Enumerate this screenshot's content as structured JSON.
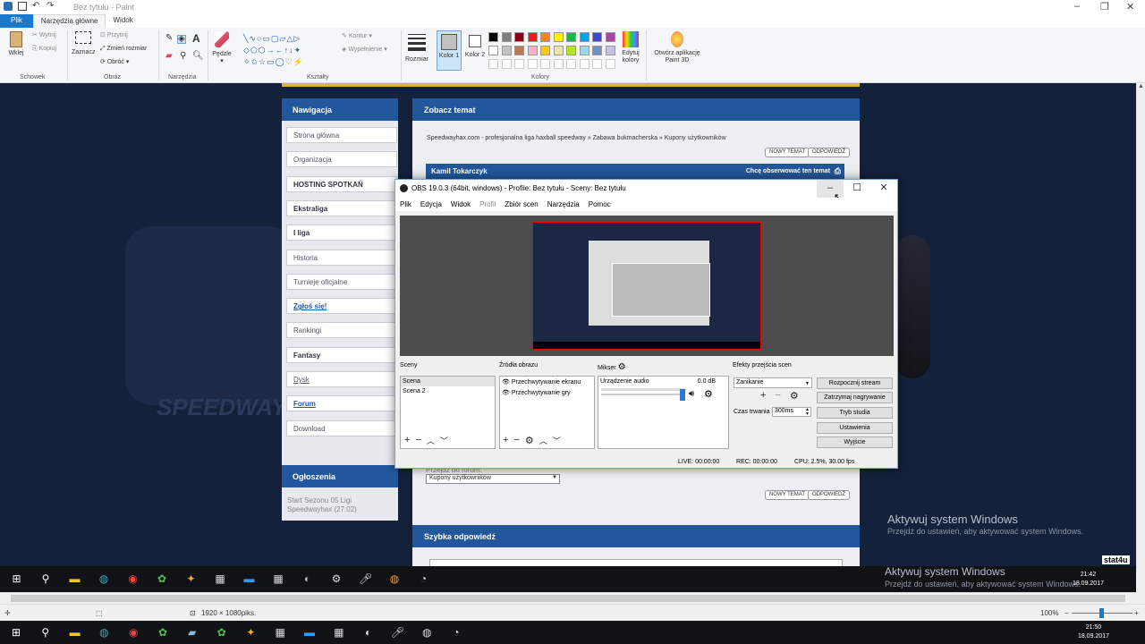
{
  "paint": {
    "title": "Bez tytułu - Paint",
    "tabs": [
      "Plik",
      "Narzędzia główne",
      "Widok"
    ],
    "groups": {
      "clipboard": {
        "label": "Schowek",
        "paste": "Wklej",
        "cut": "Wytnij",
        "copy": "Kopiuj"
      },
      "image": {
        "label": "Obraz",
        "select": "Zaznacz",
        "crop": "Przytnij",
        "resize": "Zmień rozmiar",
        "rotate": "Obróć"
      },
      "tools": {
        "label": "Narzędzia"
      },
      "brushes": {
        "label": "Pędzle"
      },
      "shapes": {
        "label": "Kształty",
        "outline": "Kontur",
        "fill": "Wypełnienie"
      },
      "size": {
        "label": "Rozmiar"
      },
      "colors": {
        "label": "Kolory",
        "color1": "Kolor 1",
        "color2": "Kolor 2",
        "edit": "Edytuj kolory",
        "paint3d": "Otwórz aplikację Paint 3D"
      }
    },
    "palette_row1": [
      "#000000",
      "#7f7f7f",
      "#880015",
      "#ed1c24",
      "#ff7f27",
      "#fff200",
      "#22b14c",
      "#00a2e8",
      "#3f48cc",
      "#a349a4"
    ],
    "palette_row2": [
      "#ffffff",
      "#c3c3c3",
      "#b97a57",
      "#ffaec9",
      "#ffc90e",
      "#efe4b0",
      "#b5e61d",
      "#99d9ea",
      "#7092be",
      "#c8bfe7"
    ],
    "status": {
      "dimensions": "1920 × 1080piks.",
      "zoom": "100%"
    }
  },
  "website": {
    "nav_title": "Nawigacja",
    "nav_items": [
      {
        "label": "Strona główna",
        "style": ""
      },
      {
        "label": "Organizacja",
        "style": ""
      },
      {
        "label": "HOSTING SPOTKAŃ",
        "style": "b"
      },
      {
        "label": "Ekstraliga",
        "style": "b"
      },
      {
        "label": "I liga",
        "style": "b"
      },
      {
        "label": "Historia",
        "style": ""
      },
      {
        "label": "Turnieje oficjalne",
        "style": ""
      },
      {
        "label": "Zgłoś się!",
        "style": "u"
      },
      {
        "label": "Rankingi",
        "style": ""
      },
      {
        "label": "Fantasy",
        "style": "b"
      },
      {
        "label": "Dysk",
        "style": "ul"
      },
      {
        "label": "Forum",
        "style": "u"
      },
      {
        "label": "Download",
        "style": ""
      }
    ],
    "announcements_title": "Ogłoszenia",
    "announcement_text": "Start Sezonu 05 Ligi Speedwayhax (27.02)",
    "topic_title": "Zobacz temat",
    "breadcrumb": "Speedwayhax.com - profesjonalna liga haxball speedway » Zabawa bukmacherska » Kupony użytkowników",
    "new_topic": "NOWY TEMAT",
    "reply": "ODPOWIEDŹ",
    "post_author": "Kamil Tokarczyk",
    "watch_topic": "Chcę obserwować ten temat",
    "jump_label": "Przejdź do forum:",
    "jump_value": "Kupony użytkowników",
    "quick_reply": "Szybka odpowiedź",
    "banner_text": "SPEEDWAY",
    "stat_badge": "stat4u",
    "activation_title": "Aktywuj system Windows",
    "activation_sub": "Przejdź do ustawień, aby aktywować system Windows."
  },
  "obs": {
    "title": "OBS 19.0.3 (64bit, windows) - Profile: Bez tytułu - Sceny: Bez tytułu",
    "menu": [
      "Plik",
      "Edycja",
      "Widok",
      "Profil",
      "Zbiór scen",
      "Narzędzia",
      "Pomoc"
    ],
    "scenes_label": "Sceny",
    "scenes": [
      "Scena",
      "Scena 2"
    ],
    "sources_label": "Źródła obrazu",
    "sources": [
      "Przechwytywanie ekranu",
      "Przechwytywanie gry"
    ],
    "mixer_label": "Mikser",
    "mixer_device": "Urządzenie audio",
    "mixer_db": "0.0 dB",
    "transitions_label": "Efekty przejścia scen",
    "transition_value": "Zanikanie",
    "duration_label": "Czas trwania",
    "duration_value": "300ms",
    "buttons": [
      "Rozpocznij stream",
      "Zatrzymaj nagrywanie",
      "Tryb studia",
      "Ustawienia",
      "Wyjście"
    ],
    "status": {
      "live": "LIVE: 00:00:00",
      "rec": "REC: 00:00:00",
      "cpu": "CPU: 2.5%, 30.00 fps"
    }
  },
  "inner_clock": {
    "time": "21:42",
    "date": "18.09.2017"
  },
  "clock": {
    "time": "21:50",
    "date": "18.09.2017"
  }
}
